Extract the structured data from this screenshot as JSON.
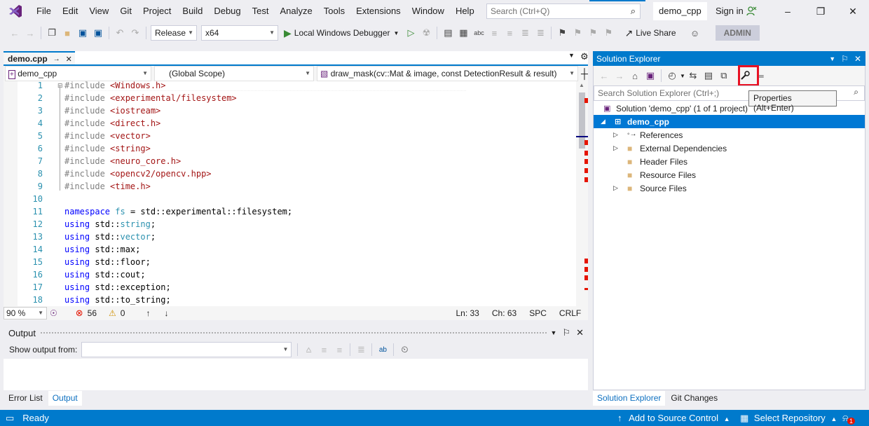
{
  "menubar": {
    "items": [
      "File",
      "Edit",
      "View",
      "Git",
      "Project",
      "Build",
      "Debug",
      "Test",
      "Analyze",
      "Tools",
      "Extensions",
      "Window",
      "Help"
    ],
    "search_placeholder": "Search (Ctrl+Q)",
    "project_name": "demo_cpp",
    "sign_in": "Sign in"
  },
  "toolbar": {
    "config": "Release",
    "platform": "x64",
    "debugger": "Local Windows Debugger",
    "live_share": "Live Share",
    "admin": "ADMIN"
  },
  "editor": {
    "tab_label": "demo.cpp",
    "nav_project": "demo_cpp",
    "nav_scope": "(Global Scope)",
    "nav_function": "draw_mask(cv::Mat & image, const DetectionResult & result)",
    "lines": [
      {
        "n": "1",
        "t": "#include <Windows.h>"
      },
      {
        "n": "2",
        "t": "#include <experimental/filesystem>"
      },
      {
        "n": "3",
        "t": "#include <iostream>"
      },
      {
        "n": "4",
        "t": "#include <direct.h>"
      },
      {
        "n": "5",
        "t": "#include <vector>"
      },
      {
        "n": "6",
        "t": "#include <string>"
      },
      {
        "n": "7",
        "t": "#include <neuro_core.h>"
      },
      {
        "n": "8",
        "t": "#include <opencv2/opencv.hpp>"
      },
      {
        "n": "9",
        "t": "#include <time.h>"
      },
      {
        "n": "10",
        "t": ""
      },
      {
        "n": "11",
        "t": "namespace fs = std::experimental::filesystem;"
      },
      {
        "n": "12",
        "t": "using std::string;"
      },
      {
        "n": "13",
        "t": "using std::vector;"
      },
      {
        "n": "14",
        "t": "using std::max;"
      },
      {
        "n": "15",
        "t": "using std::floor;"
      },
      {
        "n": "16",
        "t": "using std::cout;"
      },
      {
        "n": "17",
        "t": "using std::exception;"
      },
      {
        "n": "18",
        "t": "using std::to_string;"
      }
    ],
    "status": {
      "zoom": "90 %",
      "errors": "56",
      "warnings": "0",
      "ln": "Ln: 33",
      "ch": "Ch: 63",
      "spc": "SPC",
      "crlf": "CRLF"
    }
  },
  "output": {
    "title": "Output",
    "show_from_label": "Show output from:",
    "show_from_value": ""
  },
  "bottom_tabs": [
    "Error List",
    "Output"
  ],
  "solution_explorer": {
    "title": "Solution Explorer",
    "search_placeholder": "Search Solution Explorer (Ctrl+;)",
    "tooltip": "Properties (Alt+Enter)",
    "tree": [
      {
        "label": "Solution 'demo_cpp' (1 of 1 project)"
      },
      {
        "label": "demo_cpp"
      },
      {
        "label": "References"
      },
      {
        "label": "External Dependencies"
      },
      {
        "label": "Header Files"
      },
      {
        "label": "Resource Files"
      },
      {
        "label": "Source Files"
      }
    ],
    "tabs": [
      "Solution Explorer",
      "Git Changes"
    ]
  },
  "statusbar": {
    "ready": "Ready",
    "add_source": "Add to Source Control",
    "select_repo": "Select Repository",
    "notif_count": "1"
  }
}
